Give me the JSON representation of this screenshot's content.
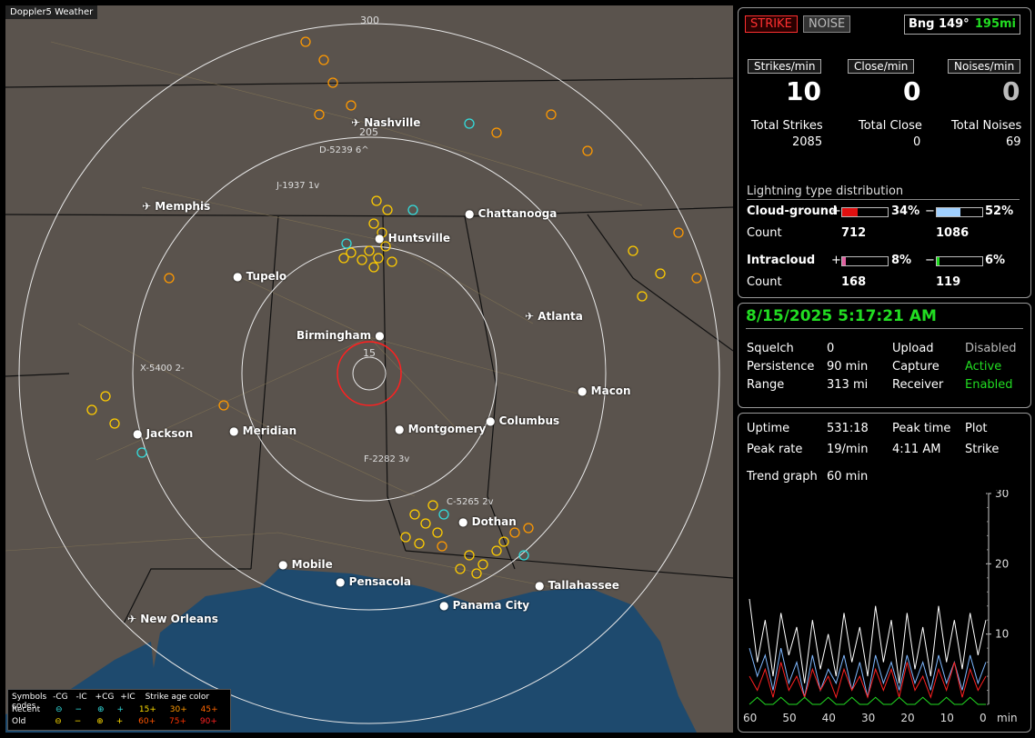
{
  "map": {
    "title": "Doppler5 Weather",
    "ring_labels": [
      "300",
      "205",
      "15"
    ],
    "cities": [
      {
        "name": "Nashville",
        "plane": true
      },
      {
        "name": "Memphis",
        "plane": true
      },
      {
        "name": "Chattanooga",
        "plane": false
      },
      {
        "name": "Huntsville",
        "plane": false
      },
      {
        "name": "Tupelo",
        "plane": false
      },
      {
        "name": "Atlanta",
        "plane": true
      },
      {
        "name": "Birmingham",
        "plane": false
      },
      {
        "name": "Macon",
        "plane": false
      },
      {
        "name": "Jackson",
        "plane": false
      },
      {
        "name": "Meridian",
        "plane": false
      },
      {
        "name": "Montgomery",
        "plane": false
      },
      {
        "name": "Columbus",
        "plane": false
      },
      {
        "name": "Dothan",
        "plane": false
      },
      {
        "name": "Mobile",
        "plane": false
      },
      {
        "name": "Pensacola",
        "plane": false
      },
      {
        "name": "Tallahassee",
        "plane": false
      },
      {
        "name": "Panama City",
        "plane": false
      },
      {
        "name": "New Orleans",
        "plane": true
      }
    ],
    "stations": [
      "D-5239 6^",
      "J-1937 1v",
      "X-5400 2-",
      "F-2282 3v",
      "C-5265 2v"
    ],
    "legend": {
      "header": [
        "Symbols",
        "-CG",
        "-IC",
        "+CG",
        "+IC",
        "Strike age color codes"
      ],
      "recent_label": "Recent",
      "old_label": "Old",
      "recent_codes": [
        "15+",
        "30+",
        "45+"
      ],
      "old_codes": [
        "60+",
        "75+",
        "90+"
      ],
      "code_colors": [
        "#ffdd00",
        "#ff9900",
        "#ff6600",
        "#ff5500",
        "#ff3300",
        "#ff2222"
      ]
    }
  },
  "top": {
    "strike_button": "STRIKE",
    "noise_button": "NOISE",
    "bearing": "Bng 149°",
    "distance": "195mi",
    "rates": [
      {
        "label": "Strikes/min",
        "value": "10"
      },
      {
        "label": "Close/min",
        "value": "0"
      },
      {
        "label": "Noises/min",
        "value": "0"
      }
    ],
    "totals": [
      {
        "label": "Total Strikes",
        "value": "2085"
      },
      {
        "label": "Total Close",
        "value": "0"
      },
      {
        "label": "Total Noises",
        "value": "69"
      }
    ],
    "dist_title": "Lightning type distribution",
    "cg_label": "Cloud-ground",
    "ic_label": "Intracloud",
    "count_label": "Count",
    "plus": "+",
    "minus": "−",
    "cg_pos_pct": "34%",
    "cg_neg_pct": "52%",
    "cg_pos_count": "712",
    "cg_neg_count": "1086",
    "ic_pos_pct": "8%",
    "ic_neg_pct": "6%",
    "ic_pos_count": "168",
    "ic_neg_count": "119",
    "fractions": {
      "cg_pos": 0.34,
      "cg_neg": 0.52,
      "ic_pos": 0.08,
      "ic_neg": 0.06
    },
    "colors": {
      "cg_pos": "#e01010",
      "cg_neg": "#a0d0ff",
      "ic_pos": "#e060a0",
      "ic_neg": "#22dd22"
    }
  },
  "status": {
    "datetime": "8/15/2025 5:17:21 AM",
    "rows": [
      {
        "k1": "Squelch",
        "v1": "0",
        "k2": "Upload",
        "v2": "Disabled",
        "v2green": false
      },
      {
        "k1": "Persistence",
        "v1": "90 min",
        "k2": "Capture",
        "v2": "Active",
        "v2green": true
      },
      {
        "k1": "Range",
        "v1": "313 mi",
        "k2": "Receiver",
        "v2": "Enabled",
        "v2green": true
      }
    ]
  },
  "stats": {
    "uptime_label": "Uptime",
    "uptime": "531:18",
    "peaktime_label": "Peak time",
    "plot_label": "Plot",
    "peakrate_label": "Peak rate",
    "peakrate": "19/min",
    "peaktime": "4:11 AM",
    "plot": "Strike",
    "trend_label": "Trend graph",
    "trend": "60 min"
  },
  "chart_data": {
    "type": "line",
    "x": [
      60,
      58,
      56,
      54,
      52,
      50,
      48,
      46,
      44,
      42,
      40,
      38,
      36,
      34,
      32,
      30,
      28,
      26,
      24,
      22,
      20,
      18,
      16,
      14,
      12,
      10,
      8,
      6,
      4,
      2,
      0
    ],
    "xticks": [
      "60",
      "50",
      "40",
      "30",
      "20",
      "10",
      "0"
    ],
    "xunit": "min",
    "yticks": [
      "30",
      "20",
      "10"
    ],
    "ylim": [
      0,
      30
    ],
    "series": [
      {
        "color": "#ffffff",
        "values": [
          15,
          6,
          12,
          4,
          13,
          7,
          11,
          3,
          12,
          5,
          10,
          4,
          13,
          6,
          11,
          4,
          14,
          6,
          12,
          3,
          13,
          5,
          11,
          4,
          14,
          6,
          12,
          5,
          13,
          7,
          12
        ]
      },
      {
        "color": "#7fb8ff",
        "values": [
          8,
          4,
          7,
          2,
          8,
          3,
          6,
          1,
          7,
          2,
          5,
          3,
          7,
          2,
          6,
          1,
          7,
          3,
          6,
          2,
          7,
          3,
          6,
          2,
          7,
          3,
          6,
          2,
          7,
          3,
          6
        ]
      },
      {
        "color": "#ff2020",
        "values": [
          4,
          2,
          5,
          1,
          6,
          2,
          4,
          1,
          5,
          2,
          4,
          1,
          5,
          2,
          4,
          1,
          5,
          2,
          5,
          1,
          6,
          2,
          4,
          1,
          5,
          2,
          6,
          1,
          5,
          2,
          4
        ]
      },
      {
        "color": "#22dd22",
        "values": [
          0,
          1,
          0,
          0,
          1,
          0,
          0,
          1,
          0,
          0,
          1,
          0,
          0,
          1,
          0,
          0,
          1,
          0,
          0,
          1,
          0,
          0,
          1,
          0,
          0,
          1,
          0,
          0,
          1,
          0,
          0
        ]
      }
    ]
  }
}
